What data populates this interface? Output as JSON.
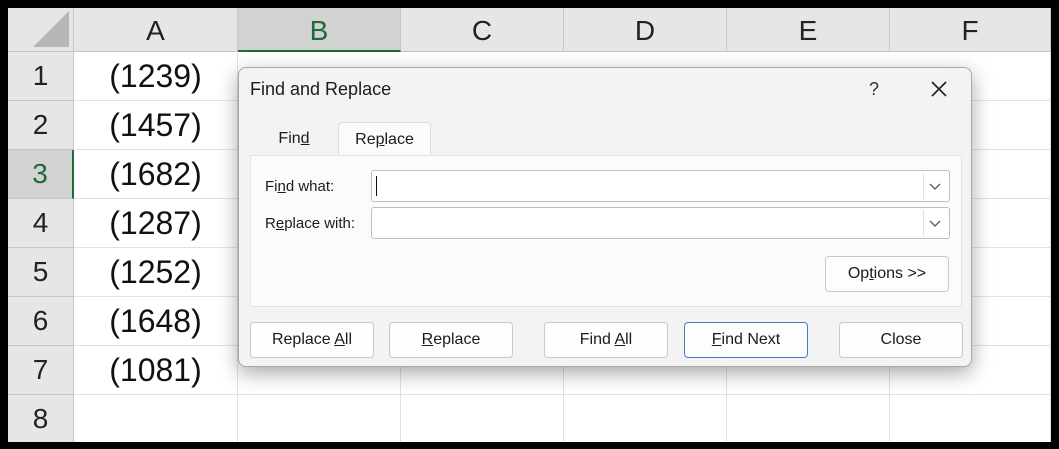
{
  "sheet": {
    "columns": [
      "A",
      "B",
      "C",
      "D",
      "E",
      "F"
    ],
    "selected_column": "B",
    "rows": [
      "1",
      "2",
      "3",
      "4",
      "5",
      "6",
      "7",
      "8"
    ],
    "selected_row": "3",
    "column_a_values": [
      "(1239)",
      "(1457)",
      "(1682)",
      "(1287)",
      "(1252)",
      "(1648)",
      "(1081)",
      ""
    ]
  },
  "dialog": {
    "title": "Find and Replace",
    "help_label": "?",
    "tabs": [
      {
        "pre": "Fin",
        "key": "d",
        "post": ""
      },
      {
        "pre": "Re",
        "key": "p",
        "post": "lace"
      }
    ],
    "active_tab": "Replace",
    "find_what": {
      "pre": "Fi",
      "key": "n",
      "post": "d what:",
      "value": ""
    },
    "replace_with": {
      "pre": "R",
      "key": "e",
      "post": "place with:",
      "value": ""
    },
    "options_button": {
      "pre": "Op",
      "key": "t",
      "post": "ions >>"
    },
    "buttons": {
      "replace_all": {
        "pre": "Replace ",
        "key": "A",
        "post": "ll"
      },
      "replace": {
        "pre": "",
        "key": "R",
        "post": "eplace"
      },
      "find_all": {
        "pre": "Find ",
        "key": "A",
        "post": "ll"
      },
      "find_next": {
        "pre": "",
        "key": "F",
        "post": "ind Next"
      },
      "close": {
        "pre": "Close",
        "key": "",
        "post": ""
      }
    }
  }
}
